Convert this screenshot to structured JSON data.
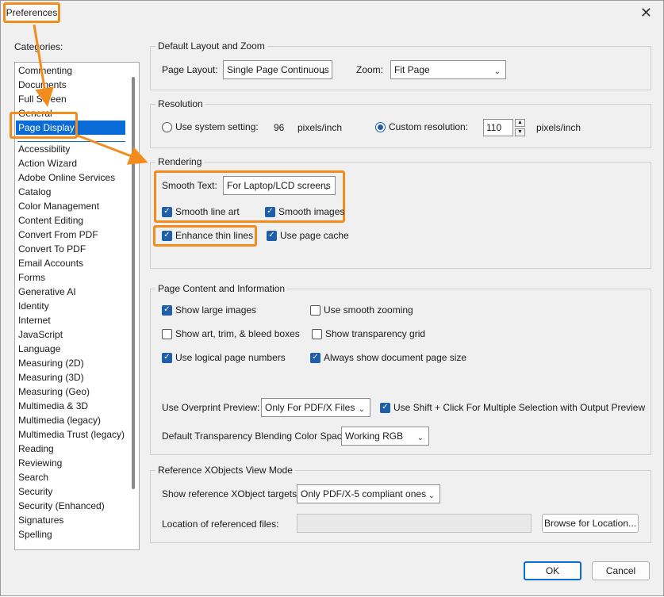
{
  "window": {
    "title": "Preferences",
    "close_glyph": "✕"
  },
  "categories": {
    "label": "Categories:",
    "items": [
      "Commenting",
      "Documents",
      "Full Screen",
      "General",
      "Page Display",
      "Accessibility",
      "Action Wizard",
      "Adobe Online Services",
      "Catalog",
      "Color Management",
      "Content Editing",
      "Convert From PDF",
      "Convert To PDF",
      "Email Accounts",
      "Forms",
      "Generative AI",
      "Identity",
      "Internet",
      "JavaScript",
      "Language",
      "Measuring (2D)",
      "Measuring (3D)",
      "Measuring (Geo)",
      "Multimedia & 3D",
      "Multimedia (legacy)",
      "Multimedia Trust (legacy)",
      "Reading",
      "Reviewing",
      "Search",
      "Security",
      "Security (Enhanced)",
      "Signatures",
      "Spelling"
    ],
    "selected": "Page Display"
  },
  "layout_zoom": {
    "title": "Default Layout and Zoom",
    "page_layout_label": "Page Layout:",
    "page_layout_value": "Single Page Continuous",
    "zoom_label": "Zoom:",
    "zoom_value": "Fit Page"
  },
  "resolution": {
    "title": "Resolution",
    "use_system_label": "Use system setting:",
    "system_value": "96",
    "system_unit": "pixels/inch",
    "use_system_selected": false,
    "custom_label": "Custom resolution:",
    "custom_value": "110",
    "custom_unit": "pixels/inch",
    "custom_selected": true
  },
  "rendering": {
    "title": "Rendering",
    "smooth_text_label": "Smooth Text:",
    "smooth_text_value": "For Laptop/LCD screens",
    "smooth_line_art": {
      "label": "Smooth line art",
      "checked": true
    },
    "smooth_images": {
      "label": "Smooth images",
      "checked": true
    },
    "enhance_thin_lines": {
      "label": "Enhance thin lines",
      "checked": true
    },
    "use_page_cache": {
      "label": "Use page cache",
      "checked": true
    }
  },
  "page_content": {
    "title": "Page Content and Information",
    "show_large_images": {
      "label": "Show large images",
      "checked": true
    },
    "use_smooth_zooming": {
      "label": "Use smooth zooming",
      "checked": false
    },
    "show_art_boxes": {
      "label": "Show art, trim, & bleed boxes",
      "checked": false
    },
    "show_transparency_grid": {
      "label": "Show transparency grid",
      "checked": false
    },
    "use_logical_page_numbers": {
      "label": "Use logical page numbers",
      "checked": true
    },
    "always_show_page_size": {
      "label": "Always show document page size",
      "checked": true
    },
    "overprint_label": "Use Overprint Preview:",
    "overprint_value": "Only For PDF/X Files",
    "shift_click": {
      "label": "Use Shift + Click For Multiple Selection with Output Preview",
      "checked": true
    },
    "blending_label": "Default Transparency Blending Color Space:",
    "blending_value": "Working RGB"
  },
  "xobjects": {
    "title": "Reference XObjects View Mode",
    "targets_label": "Show reference XObject targets:",
    "targets_value": "Only PDF/X-5 compliant ones",
    "location_label": "Location of referenced files:",
    "location_value": "",
    "browse_label": "Browse for Location..."
  },
  "buttons": {
    "ok": "OK",
    "cancel": "Cancel"
  },
  "icons": {
    "chevron": "chevron-down-icon",
    "check": "check-icon",
    "close": "close-icon"
  },
  "colors": {
    "highlight": "#f28c1c",
    "selection": "#0a6ad6",
    "check": "#1f5fa8"
  }
}
